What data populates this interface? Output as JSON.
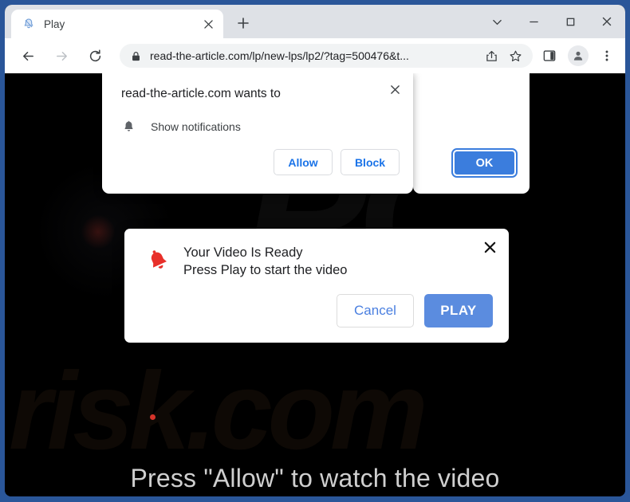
{
  "window": {
    "controls": {
      "tab_search_label": "Tab search",
      "minimize_label": "Minimize",
      "maximize_label": "Maximize",
      "close_label": "Close"
    }
  },
  "tabstrip": {
    "tab": {
      "favicon": "bell-icon",
      "title": "Play",
      "close_label": "Close tab"
    },
    "new_tab_label": "New tab"
  },
  "toolbar": {
    "back_label": "Back",
    "forward_label": "Forward",
    "reload_label": "Reload",
    "lock_icon": "lock-icon",
    "url": "read-the-article.com/lp/new-lps/lp2/?tag=500476&t...",
    "url_host": "read-the-article.com",
    "url_path": "/lp/new-lps/lp2/?tag=500476&t...",
    "share_label": "Share this page",
    "bookmark_label": "Bookmark this tab",
    "side_panel_label": "Side panel",
    "profile_label": "Profile",
    "menu_label": "Customize and control Google Chrome"
  },
  "permission_bubble": {
    "title": "read-the-article.com wants to",
    "close_label": "Close",
    "permission_icon": "bell-icon",
    "permission_label": "Show notifications",
    "allow_label": "Allow",
    "block_label": "Block",
    "ok_label": "OK"
  },
  "video_dialog": {
    "icon": "bell-icon",
    "close_label": "Close",
    "heading": "Your Video Is Ready",
    "subheading": "Press Play to start the video",
    "cancel_label": "Cancel",
    "play_label": "PLAY"
  },
  "page": {
    "headline": "Press \"Allow\" to watch the video",
    "watermark_top": "PC",
    "watermark_bottom": "risk.com",
    "background_color": "#000000"
  },
  "colors": {
    "window_frame": "#2a5699",
    "tabstrip": "#dee1e6",
    "omnibox": "#f1f3f4",
    "link_blue": "#1a73e8",
    "ok_blue": "#3b7ddd",
    "play_blue": "#5b8cdf",
    "bell_red": "#e8302a",
    "page_text": "#cfcfcf"
  }
}
